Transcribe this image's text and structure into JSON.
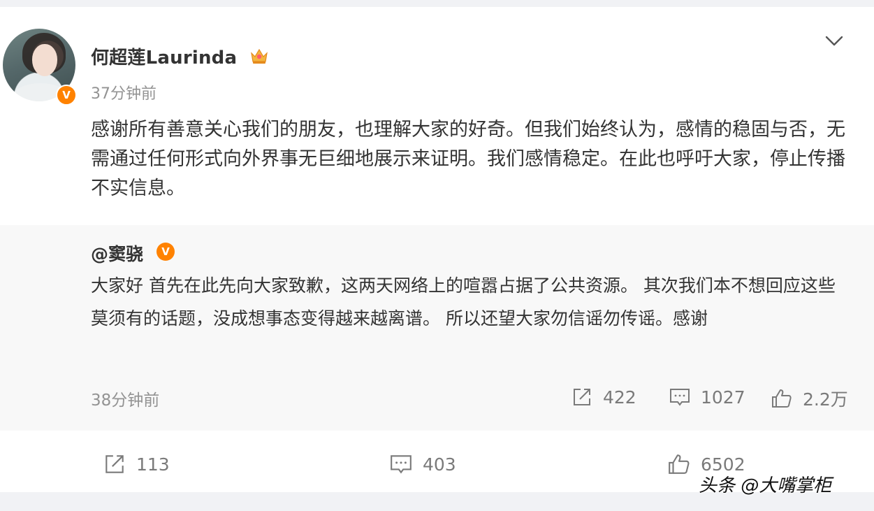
{
  "post": {
    "author": "何超莲Laurinda",
    "time": "37分钟前",
    "text": "感谢所有善意关心我们的朋友，也理解大家的好奇。但我们始终认为，感情的稳固与否，无需通过任何形式向外界事无巨细地展示来证明。我们感情稳定。在此也呼吁大家，停止传播不实信息。",
    "icons": {
      "verified": "orange-verified-v-icon",
      "member": "crown-badge-icon",
      "more": "chevron-down-icon"
    }
  },
  "repost": {
    "author": "@窦骁",
    "verified_label": "V",
    "text": "大家好 首先在此先向大家致歉，这两天网络上的喧嚣占据了公共资源。 其次我们本不想回应这些莫须有的话题，没成想事态变得越来越离谱。 所以还望大家勿信谣勿传谣。感谢",
    "time": "38分钟前",
    "shares": "422",
    "comments": "1027",
    "likes": "2.2万"
  },
  "footer": {
    "shares": "113",
    "comments": "403",
    "likes": "6502"
  },
  "avatar_badge": "V",
  "watermark": "头条 @大嘴掌柜",
  "colors": {
    "accent": "#ff8200",
    "text": "#333333",
    "muted": "#939393",
    "repost_bg": "#f8f8f8",
    "page_bg": "#f1f2f5"
  }
}
